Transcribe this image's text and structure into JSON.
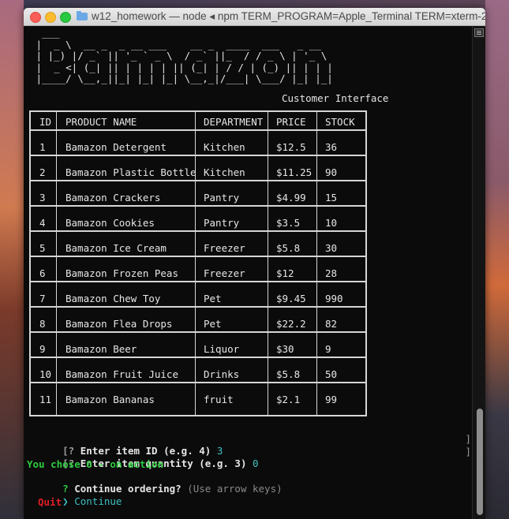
{
  "window": {
    "title": "w12_homework — node ◂ npm TERM_PROGRAM=Apple_Terminal TERM=xterm-2..."
  },
  "terminal": {
    "logo_ascii": "  ___\n |  _ \\  __ _  _ __ ___    __ _  ____  ___   _ __\n | |_) |/ _` || '_ ` _ \\  / _` ||_  / / _ \\ | '_ \\\n |  _ <| (_| || | | | | || (_| | / / | (_) || | | |\n |____/ \\__,_||_| |_| |_| \\__,_|/___| \\___/ |_| |_|",
    "subtitle": "Customer Interface",
    "table": {
      "headers": [
        "ID",
        "PRODUCT NAME",
        "DEPARTMENT",
        "PRICE",
        "STOCK"
      ],
      "rows": [
        [
          "1",
          "Bamazon Detergent",
          "Kitchen",
          "$12.5",
          "36"
        ],
        [
          "2",
          "Bamazon Plastic Bottle",
          "Kitchen",
          "$11.25",
          "90"
        ],
        [
          "3",
          "Bamazon Crackers",
          "Pantry",
          "$4.99",
          "15"
        ],
        [
          "4",
          "Bamazon Cookies",
          "Pantry",
          "$3.5",
          "10"
        ],
        [
          "5",
          "Bamazon Ice Cream",
          "Freezer",
          "$5.8",
          "30"
        ],
        [
          "6",
          "Bamazon Frozen Peas",
          "Freezer",
          "$12",
          "28"
        ],
        [
          "7",
          "Bamazon Chew Toy",
          "Pet",
          "$9.45",
          "990"
        ],
        [
          "8",
          "Bamazon Flea Drops",
          "Pet",
          "$22.2",
          "82"
        ],
        [
          "9",
          "Bamazon Beer",
          "Liquor",
          "$30",
          "9"
        ],
        [
          "10",
          "Bamazon Fruit Juice",
          "Drinks",
          "$5.8",
          "50"
        ],
        [
          "11",
          "Bamazon Bananas",
          "fruit",
          "$2.1",
          "99"
        ]
      ]
    },
    "prompts": {
      "q1_prefix": "[?",
      "q1_label": "Enter item ID (e.g. 4)",
      "q1_value": "3",
      "q2_prefix": "[?",
      "q2_label": "Enter item quantity (e.g. 3)",
      "q2_value": "0",
      "message": "You chose 0 - on action",
      "q3_prefix": "?",
      "q3_label": "Continue ordering?",
      "q3_hint": "(Use arrow keys)",
      "option_pointer": "❯",
      "option_continue": "Continue",
      "option_quit": "Quit"
    }
  }
}
